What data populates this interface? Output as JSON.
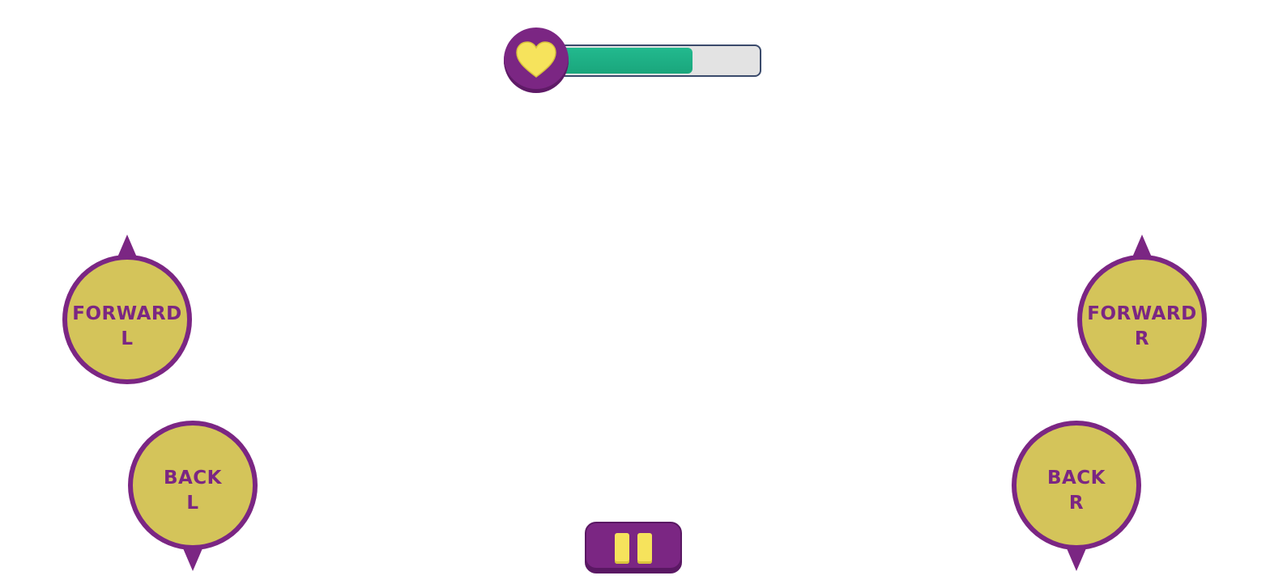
{
  "health": {
    "icon": "heart-icon",
    "fill_fraction": 0.7,
    "fill_color": "#1fb383",
    "track_color": "#e3e3e3"
  },
  "controls": {
    "forward_left": {
      "label": "FORWARD\nL",
      "icon": "arrow-up"
    },
    "forward_right": {
      "label": "FORWARD\nR",
      "icon": "arrow-up"
    },
    "back_left": {
      "label": "BACK\nL",
      "icon": "arrow-down"
    },
    "back_right": {
      "label": "BACK\nR",
      "icon": "arrow-down"
    }
  },
  "pause": {
    "icon": "pause-icon"
  },
  "colors": {
    "purple": "#7b2683",
    "button_fill": "#d4c45a",
    "yellow": "#f6e35c",
    "green": "#1fb383"
  }
}
